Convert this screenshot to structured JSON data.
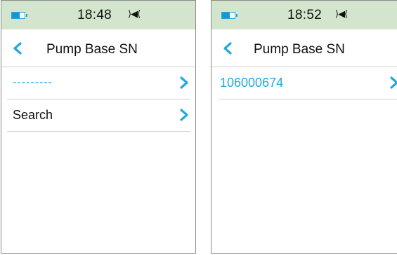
{
  "colors": {
    "status_bar_bg": "#d3e6cd",
    "accent": "#24a8e0",
    "divider": "#d0d0d0"
  },
  "icons": {
    "battery": "battery-icon",
    "sound": "sound-icon",
    "back": "back-chevron-icon",
    "row": "chevron-right-icon"
  },
  "screens": [
    {
      "status": {
        "time": "18:48",
        "sound_glyph": "⟩◀⟨"
      },
      "header": {
        "title": "Pump Base SN"
      },
      "items": [
        {
          "label": "---------"
        },
        {
          "label": "Search"
        }
      ]
    },
    {
      "status": {
        "time": "18:52",
        "sound_glyph": "⟩◀⟨"
      },
      "header": {
        "title": "Pump Base SN"
      },
      "items": [
        {
          "label": "106000674"
        }
      ]
    }
  ]
}
